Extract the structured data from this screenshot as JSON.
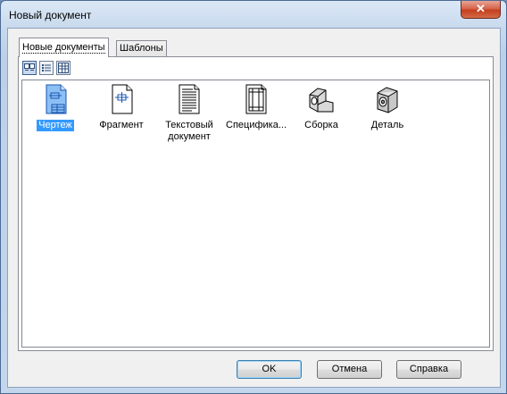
{
  "window": {
    "title": "Новый документ",
    "close_glyph": "✕"
  },
  "tabs": [
    {
      "label": "Новые документы",
      "active": true
    },
    {
      "label": "Шаблоны",
      "active": false
    }
  ],
  "view_buttons": [
    {
      "icon": "large-icons-view-icon",
      "pressed": true
    },
    {
      "icon": "list-view-icon",
      "pressed": false
    },
    {
      "icon": "details-view-icon",
      "pressed": false
    }
  ],
  "documents": [
    {
      "label": "Чертеж",
      "icon": "drawing-icon",
      "selected": true
    },
    {
      "label": "Фрагмент",
      "icon": "fragment-icon",
      "selected": false
    },
    {
      "label": "Текстовый документ",
      "icon": "text-document-icon",
      "selected": false
    },
    {
      "label": "Специфика...",
      "icon": "specification-icon",
      "selected": false
    },
    {
      "label": "Сборка",
      "icon": "assembly-icon",
      "selected": false
    },
    {
      "label": "Деталь",
      "icon": "part-icon",
      "selected": false
    }
  ],
  "buttons": {
    "ok": "OK",
    "cancel": "Отмена",
    "help": "Справка"
  },
  "colors": {
    "selection": "#3399ff",
    "titlebar": "#c9daee",
    "close": "#c4401f"
  }
}
